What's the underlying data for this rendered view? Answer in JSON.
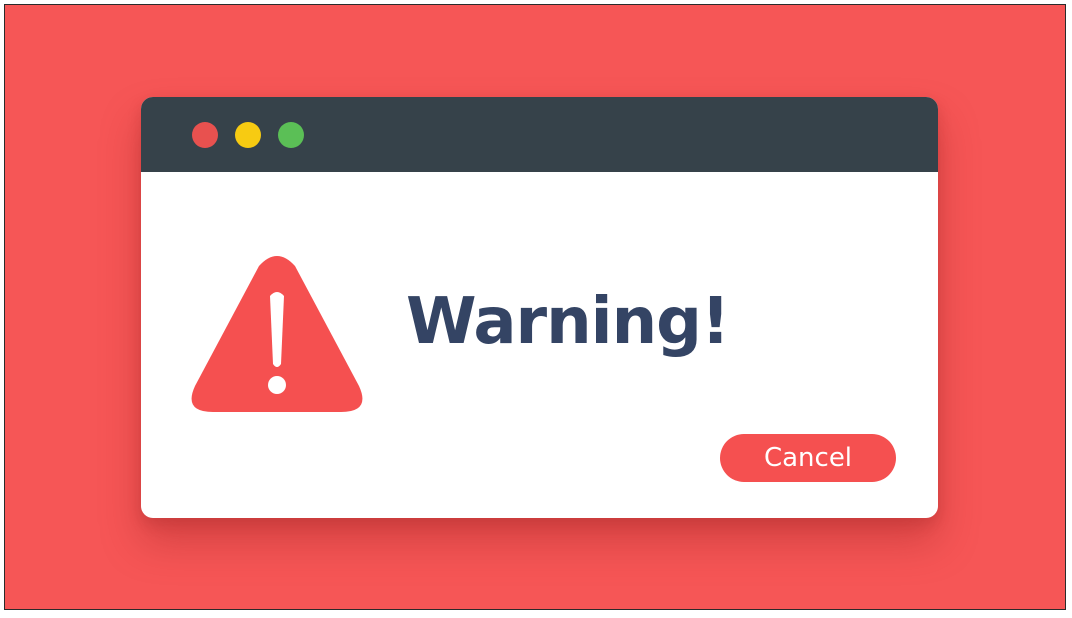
{
  "dialog": {
    "title": "Warning!",
    "cancel_label": "Cancel",
    "icon": "warning-triangle-icon"
  },
  "titlebar": {
    "buttons": [
      {
        "name": "close",
        "color": "#e8514f"
      },
      {
        "name": "minimize",
        "color": "#f7cb12"
      },
      {
        "name": "maximize",
        "color": "#5bbf56"
      }
    ]
  },
  "colors": {
    "background": "#f65656",
    "titlebar": "#36424a",
    "accent": "#f55050",
    "title_text": "#344464"
  }
}
